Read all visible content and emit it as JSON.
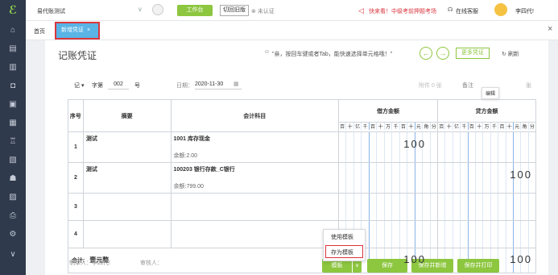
{
  "company": "易代账测试",
  "topbar": {
    "workbench": "工作台",
    "switch_new": "切回旧版",
    "unverified": "未认证",
    "notice": "快来看！中级考前押题考场",
    "online_service": "在线客服",
    "user": "李四代!"
  },
  "tabs": {
    "home": "首页",
    "active": "新增凭证",
    "close": "×"
  },
  "page": {
    "title": "记账凭证",
    "hint": "\"亲，按回车键或者Tab，能快速选择单元格哦！\"",
    "more_voucher": "更多凭证",
    "refresh": "刷新"
  },
  "voucher": {
    "word": "记",
    "word_label": "字第",
    "number": "002",
    "number_suffix": "号",
    "date_label": "日期：",
    "date": "2020-11-30",
    "attachments": "附件 0 张",
    "notes": "备注",
    "edit_tip": "编辑",
    "column_text": "张"
  },
  "table": {
    "headers": {
      "seq": "序号",
      "summary": "摘要",
      "account": "会计科目",
      "debit": "借方金额",
      "credit": "贷方金额"
    },
    "digit_units": [
      "百",
      "十",
      "亿",
      "千",
      "百",
      "十",
      "万",
      "千",
      "百",
      "十",
      "元",
      "角",
      "分"
    ],
    "rows": [
      {
        "seq": "1",
        "summary": "测试",
        "account": "1001 库存现金",
        "balance": "余额:2.00",
        "debit": "100",
        "credit": ""
      },
      {
        "seq": "2",
        "summary": "测试",
        "account": "100203 银行存款_C银行",
        "balance": "余额:799.00",
        "debit": "",
        "credit": "100"
      },
      {
        "seq": "3",
        "summary": "",
        "account": "",
        "balance": "",
        "debit": "",
        "credit": ""
      },
      {
        "seq": "4",
        "summary": "",
        "account": "",
        "balance": "",
        "debit": "",
        "credit": ""
      }
    ],
    "total_label": "合计:",
    "total_words": "壹元整",
    "total_debit": "100",
    "total_credit": "100"
  },
  "footer": {
    "preparer_label": "制单人：",
    "preparer": "李四代!",
    "reviewer_label": "审核人：",
    "template": "模板",
    "save": "保存",
    "save_new": "保存并新增",
    "save_print": "保存并打印"
  },
  "template_menu": {
    "use": "使用模板",
    "save_as": "存为模板"
  },
  "colors": {
    "accent_green": "#8dc63f",
    "tab_blue": "#5ab4e5",
    "sidebar": "#2f3a4c",
    "highlight_red": "#d9363e"
  }
}
